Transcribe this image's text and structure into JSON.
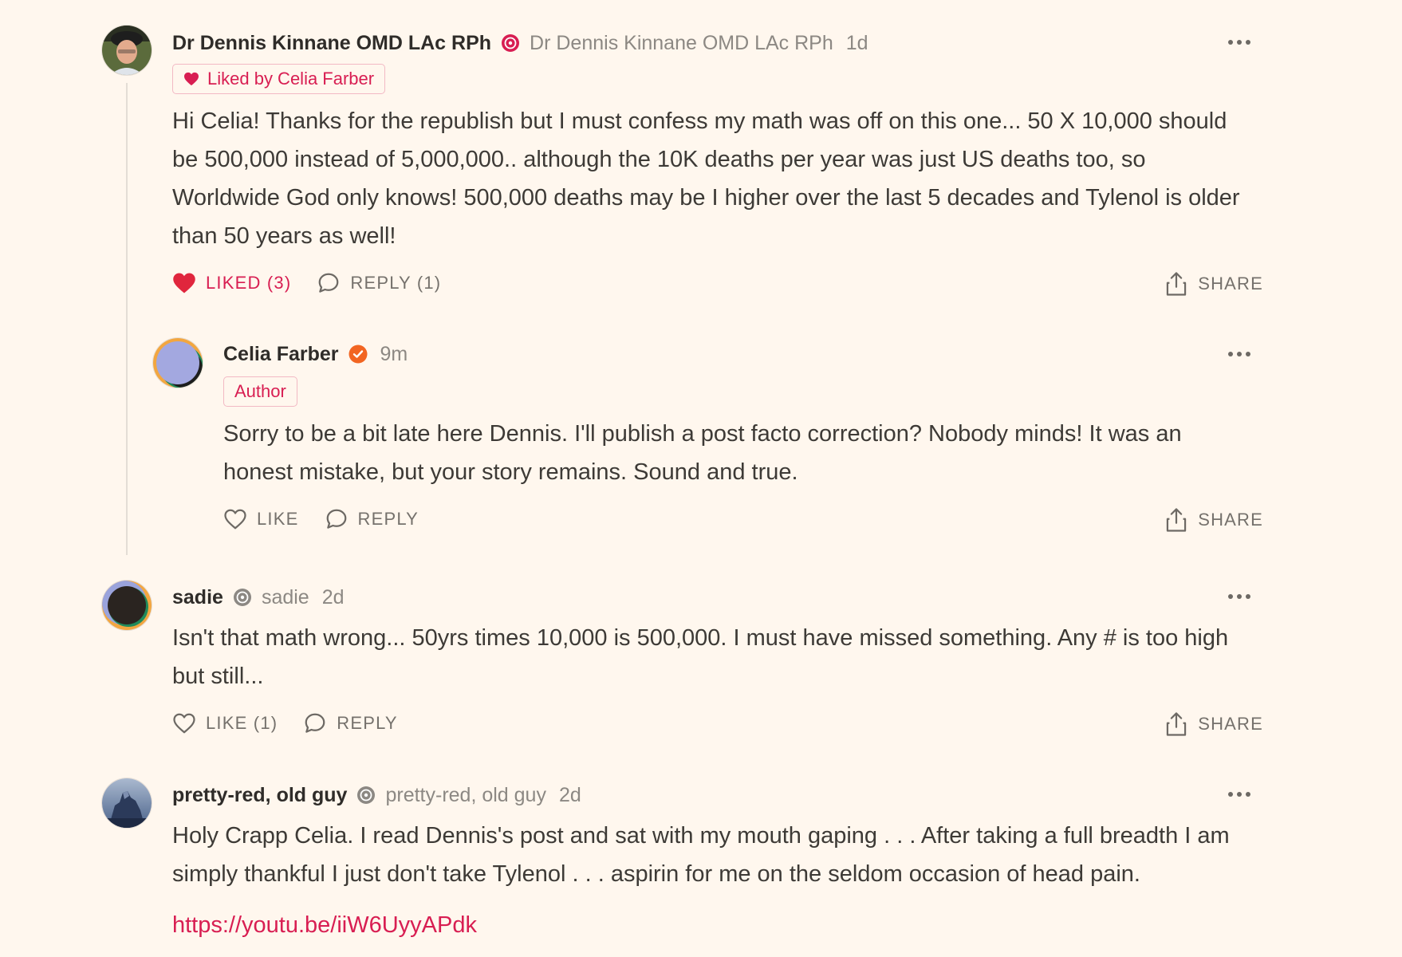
{
  "comments": [
    {
      "author": "Dr Dennis Kinnane OMD LAc RPh",
      "handle": "Dr Dennis Kinnane OMD LAc RPh",
      "time": "1d",
      "liked_by": "Liked by Celia Farber",
      "body": "Hi Celia! Thanks for the republish but I must confess my math was off on this one... 50 X 10,000 should be 500,000 instead of 5,000,000.. although the 10K deaths per year was just US deaths too, so Worldwide God only knows! 500,000 deaths may be I higher over the last 5 decades and Tylenol is older than 50 years as well!",
      "like_label": "LIKED (3)",
      "reply_label": "REPLY (1)",
      "share_label": "SHARE"
    },
    {
      "author": "Celia Farber",
      "time": "9m",
      "role_badge": "Author",
      "body": "Sorry to be a bit late here Dennis. I'll publish a post facto correction? Nobody minds! It was an honest mistake, but your story remains. Sound and true.",
      "like_label": "LIKE",
      "reply_label": "REPLY",
      "share_label": "SHARE"
    },
    {
      "author": "sadie",
      "handle": "sadie",
      "time": "2d",
      "body": "Isn't that math wrong... 50yrs times 10,000 is 500,000. I must have missed something. Any # is too high but still...",
      "like_label": "LIKE (1)",
      "reply_label": "REPLY",
      "share_label": "SHARE"
    },
    {
      "author": "pretty-red, old guy",
      "handle": "pretty-red, old guy",
      "time": "2d",
      "body": "Holy Crapp Celia. I read Dennis's post and sat with my mouth gaping . . . After taking a full breadth I am simply thankful I just don't take Tylenol . . . aspirin for me on the seldom occasion of head pain.",
      "link": "https://youtu.be/iiW6UyyAPdk"
    }
  ],
  "colors": {
    "background": "#fff7ee",
    "accent": "#d81e52",
    "verified": "#f26522",
    "muted": "#8c8883"
  },
  "icons": [
    "pledge-badge-icon",
    "verified-icon",
    "heart-icon",
    "comment-icon",
    "share-icon",
    "more-icon"
  ]
}
